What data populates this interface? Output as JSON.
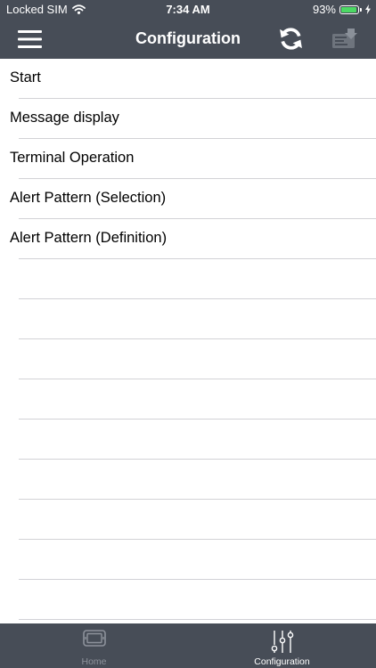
{
  "status_bar": {
    "carrier": "Locked SIM",
    "time": "7:34 AM",
    "battery_percent": "93%",
    "battery_level": 0.93,
    "battery_color": "#4cd964"
  },
  "nav_bar": {
    "title": "Configuration",
    "background": "#474d57",
    "left_icon": "hamburger-menu-icon",
    "right_icons": [
      "refresh-icon",
      "export-icon"
    ]
  },
  "list": {
    "items": [
      {
        "label": "Start"
      },
      {
        "label": "Message display"
      },
      {
        "label": "Terminal Operation"
      },
      {
        "label": "Alert Pattern (Selection)"
      },
      {
        "label": "Alert Pattern (Definition)"
      }
    ],
    "empty_rows": 9
  },
  "tab_bar": {
    "tabs": [
      {
        "label": "Home",
        "icon": "terminal-device-icon",
        "selected": false
      },
      {
        "label": "Configuration",
        "icon": "sliders-icon",
        "selected": true
      }
    ],
    "active_color": "#ffffff",
    "inactive_color": "#8d929b"
  }
}
